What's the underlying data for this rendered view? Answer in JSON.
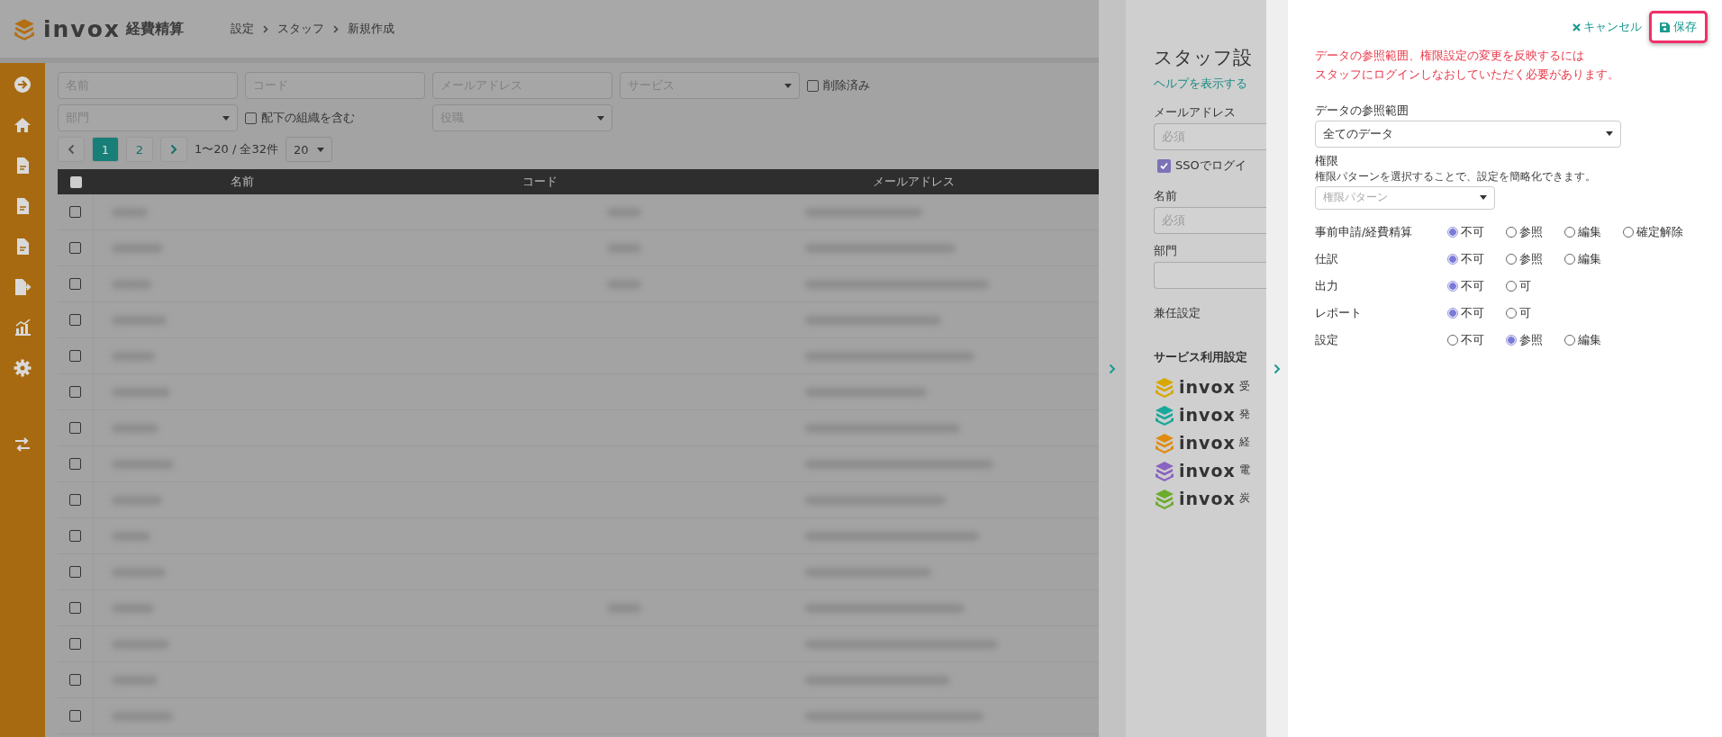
{
  "header": {
    "brand": "invox",
    "product": "経費精算",
    "breadcrumb": [
      "設定",
      "スタッフ",
      "新規作成"
    ]
  },
  "filters": {
    "rows": [
      [
        {
          "kind": "input",
          "placeholder": "名前"
        },
        {
          "kind": "input",
          "placeholder": "コード"
        },
        {
          "kind": "input",
          "placeholder": "メールアドレス"
        },
        {
          "kind": "select",
          "placeholder": "サービス"
        },
        {
          "kind": "checkbox",
          "label": "削除済み",
          "checked": false
        }
      ],
      [
        {
          "kind": "select",
          "placeholder": "部門"
        },
        {
          "kind": "checkbox",
          "label": "配下の組織を含む",
          "checked": false
        },
        {
          "kind": "select",
          "placeholder": "役職"
        }
      ]
    ]
  },
  "pager": {
    "pages": [
      {
        "label": "1",
        "selected": true
      },
      {
        "label": "2",
        "selected": false
      }
    ],
    "summary": "1〜20 / 全32件",
    "per_page": "20"
  },
  "table": {
    "header_checked": false,
    "columns": [
      "名前",
      "コード",
      "メールアドレス"
    ],
    "rows": [
      {
        "checked": false,
        "code_blurred": true
      },
      {
        "checked": false,
        "code_blurred": true
      },
      {
        "checked": false,
        "code_blurred": true
      },
      {
        "checked": false,
        "code_blurred": false
      },
      {
        "checked": false,
        "code_blurred": false
      },
      {
        "checked": false,
        "code_blurred": false
      },
      {
        "checked": false,
        "code_blurred": false
      },
      {
        "checked": false,
        "code_blurred": false
      },
      {
        "checked": false,
        "code_blurred": false
      },
      {
        "checked": false,
        "code_blurred": false
      },
      {
        "checked": false,
        "code_blurred": false
      },
      {
        "checked": false,
        "code_blurred": true
      },
      {
        "checked": false,
        "code_blurred": false
      },
      {
        "checked": false,
        "code_blurred": false
      },
      {
        "checked": false,
        "code_blurred": false
      }
    ]
  },
  "staff_panel": {
    "title": "スタッフ設",
    "help_link": "ヘルプを表示する",
    "email": {
      "label": "メールアドレス",
      "placeholder": "必須"
    },
    "sso": {
      "label": "SSOでログイ",
      "checked": true
    },
    "name": {
      "label": "名前",
      "placeholder": "必須"
    },
    "department": {
      "label": "部門"
    },
    "concurrent": "兼任設定",
    "services_heading": "サービス利用設定",
    "services": [
      {
        "brand": "invox",
        "name": "受",
        "color": "#d8a800"
      },
      {
        "brand": "invox",
        "name": "発",
        "color": "#17a89a"
      },
      {
        "brand": "invox",
        "name": "経",
        "color": "#e08c12"
      },
      {
        "brand": "invox",
        "name": "電",
        "color": "#8a64c0"
      },
      {
        "brand": "invox",
        "name": "炭",
        "color": "#6cac2c"
      }
    ]
  },
  "permission_panel": {
    "cancel": "キャンセル",
    "save": "保存",
    "save_highlighted": true,
    "warning": [
      "データの参照範囲、権限設定の変更を反映するには",
      "スタッフにログインしなおしていただく必要があります。"
    ],
    "scope": {
      "label": "データの参照範囲",
      "value": "全てのデータ"
    },
    "authority": {
      "label": "権限",
      "hint": "権限パターンを選択することで、設定を簡略化できます。",
      "placeholder": "権限パターン"
    },
    "rows": [
      {
        "label": "事前申請/経費精算",
        "options": [
          {
            "label": "不可",
            "selected": true
          },
          {
            "label": "参照",
            "selected": false
          },
          {
            "label": "編集",
            "selected": false
          },
          {
            "label": "確定解除",
            "selected": false
          }
        ]
      },
      {
        "label": "仕訳",
        "options": [
          {
            "label": "不可",
            "selected": true
          },
          {
            "label": "参照",
            "selected": false
          },
          {
            "label": "編集",
            "selected": false
          }
        ]
      },
      {
        "label": "出力",
        "options": [
          {
            "label": "不可",
            "selected": true
          },
          {
            "label": "可",
            "selected": false
          }
        ]
      },
      {
        "label": "レポート",
        "options": [
          {
            "label": "不可",
            "selected": true
          },
          {
            "label": "可",
            "selected": false
          }
        ]
      },
      {
        "label": "設定",
        "options": [
          {
            "label": "不可",
            "selected": false
          },
          {
            "label": "参照",
            "selected": true
          },
          {
            "label": "編集",
            "selected": false
          }
        ]
      }
    ]
  }
}
